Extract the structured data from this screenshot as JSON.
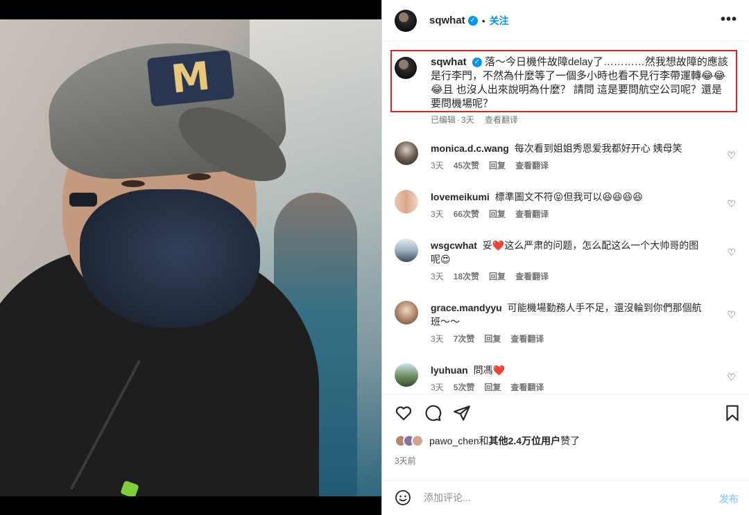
{
  "post": {
    "username": "sqwhat",
    "follow_label": "关注",
    "more_label": "•••",
    "caption_text": "落～今日機件故障delay了…………然我想故障的應該是行李門，不然為什麼等了一個多小時也看不見行李帶運轉😂😂😂且 也沒人出來說明為什麼？ 請問 這是要問航空公司呢？還是要問機場呢？",
    "caption_meta": {
      "edited": "已编辑",
      "separator": "·",
      "time": "3天",
      "translate": "查看翻译"
    }
  },
  "comments": [
    {
      "username": "monica.d.c.wang",
      "text": "每次看到姐姐秀恩爱我都好开心 姨母笑",
      "time": "3天",
      "likes": "45次赞",
      "reply": "回复",
      "translate": "查看翻译"
    },
    {
      "username": "lovemeikumi",
      "text": "標準圖文不符😝但我可以😆😆😆😆",
      "time": "3天",
      "likes": "66次赞",
      "reply": "回复",
      "translate": "查看翻译"
    },
    {
      "username": "wsgcwhat",
      "text": "妥❤️这么严肃的问题，怎么配这么一个大帅哥的图呢😍",
      "time": "3天",
      "likes": "18次赞",
      "reply": "回复",
      "translate": "查看翻译"
    },
    {
      "username": "grace.mandyyu",
      "text": "可能機場勤務人手不足，還沒輪到你們那個航班～～",
      "time": "3天",
      "likes": "7次赞",
      "reply": "回复",
      "translate": "查看翻译"
    },
    {
      "username": "lyuhuan",
      "text": "問馮❤️",
      "time": "3天",
      "likes": "5次赞",
      "reply": "回复",
      "translate": "查看翻译"
    }
  ],
  "likes": {
    "user": "pawo_chen",
    "connector": "和",
    "others": "其他2.4万位用户",
    "suffix": "赞了"
  },
  "timeago": "3天前",
  "compose": {
    "placeholder": "添加评论...",
    "post_label": "发布"
  },
  "colors": {
    "accent": "#0095f6",
    "highlight_border": "#e02020",
    "meta_text": "#737373"
  },
  "icons": [
    "heart-icon",
    "comment-icon",
    "share-icon",
    "bookmark-icon",
    "emoji-icon",
    "verified-icon",
    "more-icon"
  ]
}
